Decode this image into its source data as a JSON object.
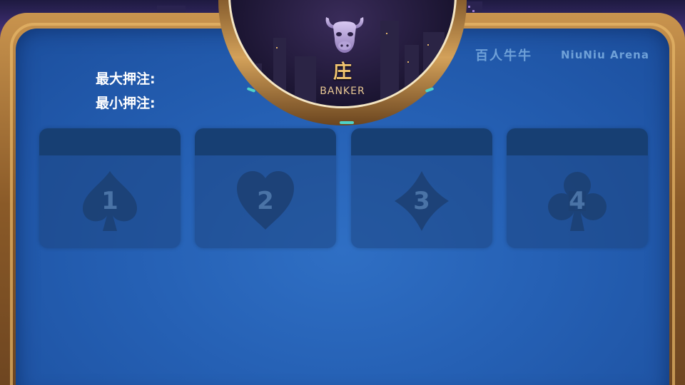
{
  "banker": {
    "label_cn": "庄",
    "label_en": "BANKER",
    "icon": "bull-head-icon"
  },
  "header": {
    "title_cn": "百人牛牛",
    "title_en": "NiuNiu Arena"
  },
  "limits": {
    "max_label": "最大押注:",
    "min_label": "最小押注:"
  },
  "bet_areas": [
    {
      "number": "1",
      "suit_icon": "spade-icon"
    },
    {
      "number": "2",
      "suit_icon": "heart-icon"
    },
    {
      "number": "3",
      "suit_icon": "diamond-icon"
    },
    {
      "number": "4",
      "suit_icon": "club-icon"
    }
  ],
  "colors": {
    "felt": "#2560b4",
    "frame_gold": "#c9944e",
    "banker_text": "#f2c571",
    "suit": "#1c3f72"
  }
}
